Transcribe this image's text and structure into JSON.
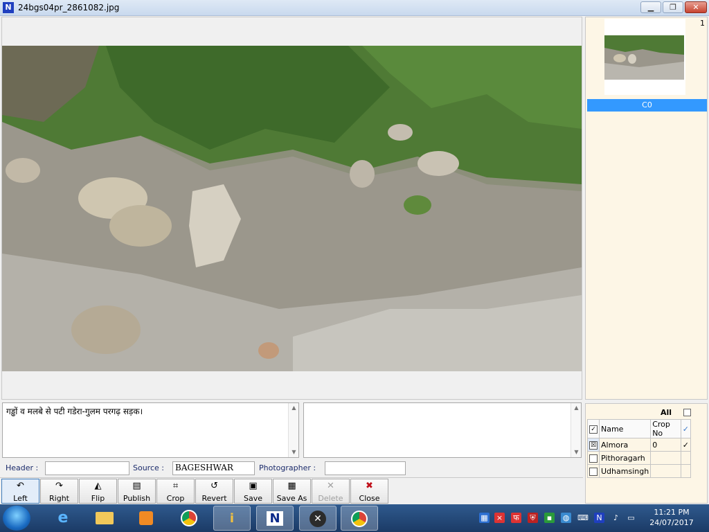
{
  "window": {
    "title": "24bgs04pr_2861082.jpg",
    "app_icon_glyph": "N",
    "minimize_glyph": "▁",
    "maximize_glyph": "❐",
    "close_glyph": "✕"
  },
  "thumbnails": {
    "count": "1",
    "items": [
      {
        "label": "C0"
      }
    ]
  },
  "caption": {
    "text": "गड्ढों व मलबे से पटी गडेरा-गुलम परगढ़ सड़क।"
  },
  "fields": {
    "header_label": "Header :",
    "header_value": "",
    "source_label": "Source :",
    "source_value": "BAGESHWAR",
    "photographer_label": "Photographer :",
    "photographer_value": ""
  },
  "toolbar": {
    "left": "Left",
    "right": "Right",
    "flip": "Flip",
    "publish": "Publish",
    "crop": "Crop",
    "revert": "Revert",
    "save": "Save",
    "save_as": "Save As",
    "delete": "Delete",
    "close": "Close"
  },
  "districts": {
    "all_label": "All",
    "col_name": "Name",
    "col_crop": "Crop No",
    "header_check": "✓",
    "rows": [
      {
        "name": "Almora",
        "crop": "0",
        "checked": "✓"
      },
      {
        "name": "Pithoragarh",
        "crop": "",
        "checked": ""
      },
      {
        "name": "Udhamsingh",
        "crop": "",
        "checked": ""
      }
    ]
  },
  "taskbar": {
    "time": "11:21 PM",
    "date": "24/07/2017"
  },
  "colors": {
    "selection": "#3399ff",
    "panel_bg": "#fdf6e6",
    "taskbar": "#1b3a66"
  }
}
